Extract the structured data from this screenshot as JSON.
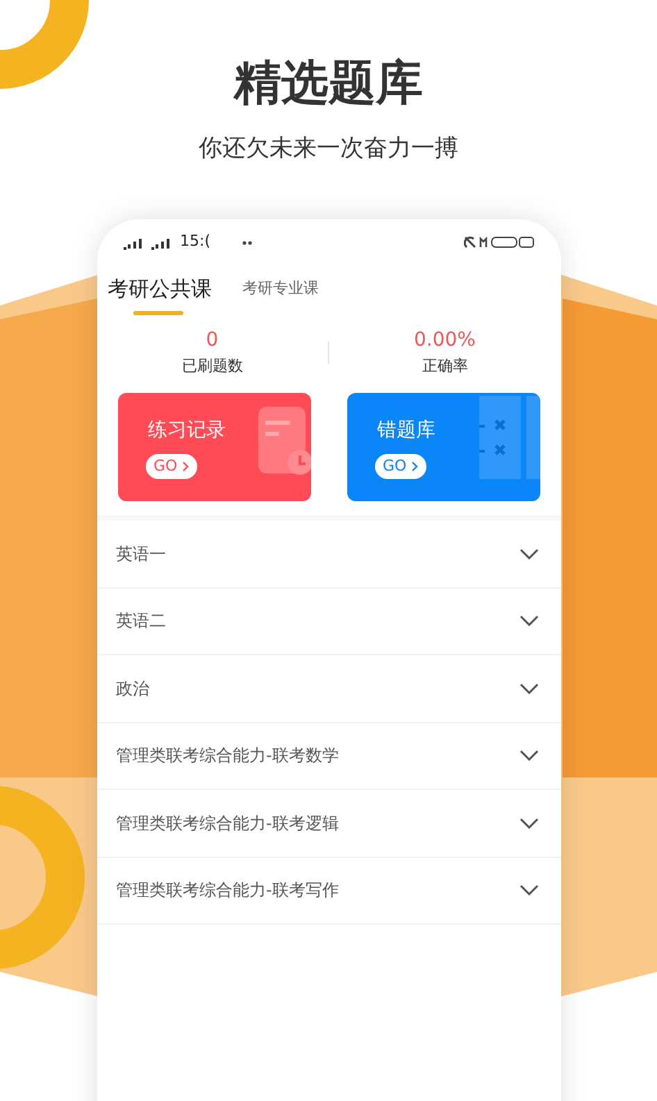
{
  "headline": {
    "title": "精选题库",
    "subtitle": "你还欠未来一次奋力一搏"
  },
  "status_bar": {
    "time": "15:("
  },
  "tabs": [
    {
      "label": "考研公共课",
      "selected": true
    },
    {
      "label": "考研专业课",
      "selected": false
    }
  ],
  "stats": [
    {
      "value": "0",
      "label": "已刷题数"
    },
    {
      "value": "0.00%",
      "label": "正确率"
    }
  ],
  "cards": [
    {
      "kind": "record",
      "title": "练习记录",
      "button": "GO",
      "color": "#fe4b55"
    },
    {
      "kind": "mistakes",
      "title": "错题库",
      "button": "GO",
      "color": "#0b86f8"
    }
  ],
  "subjects": [
    {
      "label": "英语一"
    },
    {
      "label": "英语二"
    },
    {
      "label": "政治"
    },
    {
      "label": "管理类联考综合能力-联考数学"
    },
    {
      "label": "管理类联考综合能力-联考逻辑"
    },
    {
      "label": "管理类联考综合能力-联考写作"
    }
  ]
}
